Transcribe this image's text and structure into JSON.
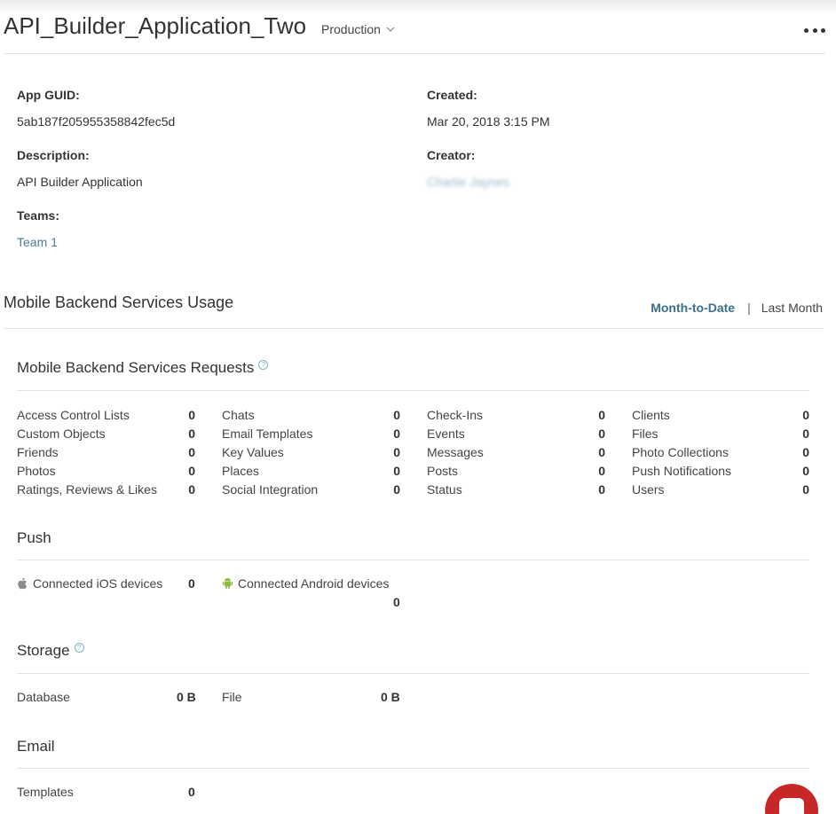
{
  "header": {
    "app_name": "API_Builder_Application_Two",
    "environment": "Production"
  },
  "info": {
    "guid_label": "App GUID:",
    "guid_value": "5ab187f205955358842fec5d",
    "created_label": "Created:",
    "created_value": "Mar 20, 2018 3:15 PM",
    "description_label": "Description:",
    "description_value": "API Builder Application",
    "creator_label": "Creator:",
    "creator_value": "Charlie Jaynes",
    "teams_label": "Teams:",
    "teams_value": "Team 1"
  },
  "usage": {
    "title": "Mobile Backend Services Usage",
    "range_active": "Month-to-Date",
    "range_separator": "|",
    "range_other": "Last Month"
  },
  "requests": {
    "title": "Mobile Backend Services Requests",
    "help": "?",
    "items": [
      {
        "label": "Access Control Lists",
        "value": "0"
      },
      {
        "label": "Chats",
        "value": "0"
      },
      {
        "label": "Check-Ins",
        "value": "0"
      },
      {
        "label": "Clients",
        "value": "0"
      },
      {
        "label": "Custom Objects",
        "value": "0"
      },
      {
        "label": "Email Templates",
        "value": "0"
      },
      {
        "label": "Events",
        "value": "0"
      },
      {
        "label": "Files",
        "value": "0"
      },
      {
        "label": "Friends",
        "value": "0"
      },
      {
        "label": "Key Values",
        "value": "0"
      },
      {
        "label": "Messages",
        "value": "0"
      },
      {
        "label": "Photo Collections",
        "value": "0"
      },
      {
        "label": "Photos",
        "value": "0"
      },
      {
        "label": "Places",
        "value": "0"
      },
      {
        "label": "Posts",
        "value": "0"
      },
      {
        "label": "Push Notifications",
        "value": "0"
      },
      {
        "label": "Ratings, Reviews & Likes",
        "value": "0"
      },
      {
        "label": "Social Integration",
        "value": "0"
      },
      {
        "label": "Status",
        "value": "0"
      },
      {
        "label": "Users",
        "value": "0"
      }
    ]
  },
  "push": {
    "title": "Push",
    "ios_label": "Connected iOS devices",
    "ios_value": "0",
    "android_label": "Connected Android devices",
    "android_value": "0",
    "ios_icon": "apple-icon",
    "android_icon": "android-icon"
  },
  "storage": {
    "title": "Storage",
    "help": "?",
    "database_label": "Database",
    "database_value": "0 B",
    "file_label": "File",
    "file_value": "0 B"
  },
  "email": {
    "title": "Email",
    "templates_label": "Templates",
    "templates_value": "0"
  },
  "colors": {
    "link": "#4a7c99",
    "active_range": "#3d6f8f",
    "chat_button": "#c62828",
    "android_green": "#8dbb3c"
  }
}
